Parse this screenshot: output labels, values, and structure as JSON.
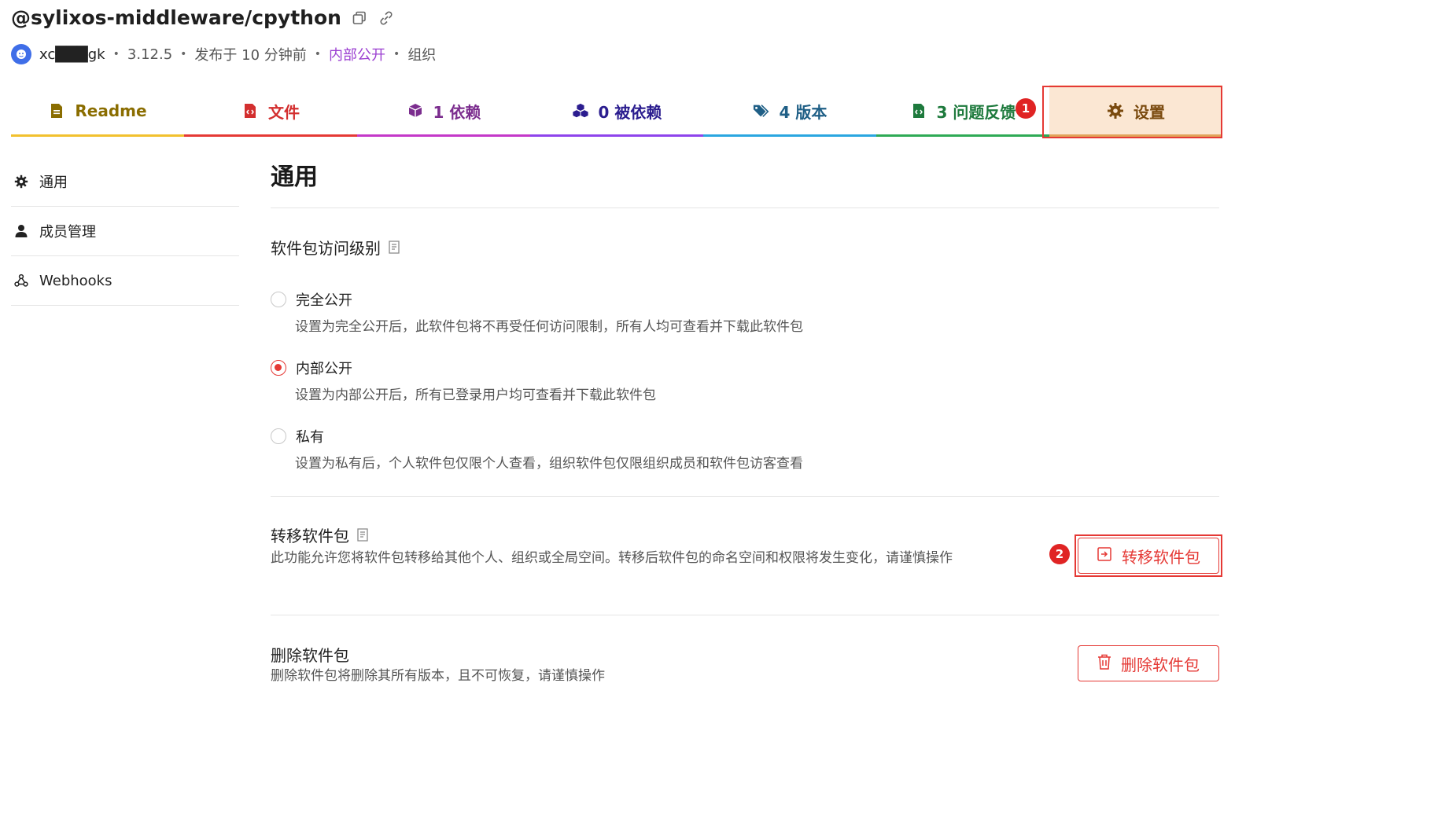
{
  "header": {
    "title": "@sylixos-middleware/cpython",
    "username": "xc███gk",
    "version": "3.12.5",
    "published": "发布于 10 分钟前",
    "visibility": "内部公开",
    "owner_type": "组织",
    "copy_icon": "copy-icon",
    "link_icon": "link-icon"
  },
  "tabs": [
    {
      "label": "Readme",
      "icon": "readme-icon",
      "color": "#8a6d00",
      "bar": "#f2c12e"
    },
    {
      "label": "文件",
      "icon": "file-code-icon",
      "color": "#d32f2f",
      "bar": "#e53935"
    },
    {
      "label": "1 依赖",
      "icon": "cube-icon",
      "color": "#7b2d8e",
      "bar": "#c438c9"
    },
    {
      "label": "0 被依赖",
      "icon": "cubes-icon",
      "color": "#2b1d8f",
      "bar": "#8e44ec"
    },
    {
      "label": "4 版本",
      "icon": "tags-icon",
      "color": "#1f5f86",
      "bar": "#2aa6e0"
    },
    {
      "label": "3 问题反馈",
      "icon": "issue-file-icon",
      "color": "#1e7a3d",
      "bar": "#2eaa55"
    },
    {
      "label": "设置",
      "icon": "gear-icon",
      "color": "#7a4a0e",
      "bar": "#e1a45a"
    }
  ],
  "annotations": {
    "badge1": "1",
    "badge2": "2"
  },
  "sidebar": {
    "items": [
      {
        "label": "通用",
        "icon": "gear-icon"
      },
      {
        "label": "成员管理",
        "icon": "user-icon"
      },
      {
        "label": "Webhooks",
        "icon": "webhook-icon"
      }
    ]
  },
  "main": {
    "heading": "通用",
    "access": {
      "title": "软件包访问级别",
      "options": [
        {
          "label": "完全公开",
          "desc": "设置为完全公开后，此软件包将不再受任何访问限制，所有人均可查看并下载此软件包",
          "checked": false
        },
        {
          "label": "内部公开",
          "desc": "设置为内部公开后，所有已登录用户均可查看并下载此软件包",
          "checked": true
        },
        {
          "label": "私有",
          "desc": "设置为私有后，个人软件包仅限个人查看，组织软件包仅限组织成员和软件包访客查看",
          "checked": false
        }
      ]
    },
    "transfer": {
      "title": "转移软件包",
      "desc": "此功能允许您将软件包转移给其他个人、组织或全局空间。转移后软件包的命名空间和权限将发生变化，请谨慎操作",
      "button": "转移软件包"
    },
    "delete": {
      "title": "删除软件包",
      "desc": "删除软件包将删除其所有版本，且不可恢复，请谨慎操作",
      "button": "删除软件包"
    }
  },
  "colors": {
    "accent": "#e53935",
    "purple": "#9b3fd1",
    "active_tab_bg": "#fbe7d3"
  }
}
